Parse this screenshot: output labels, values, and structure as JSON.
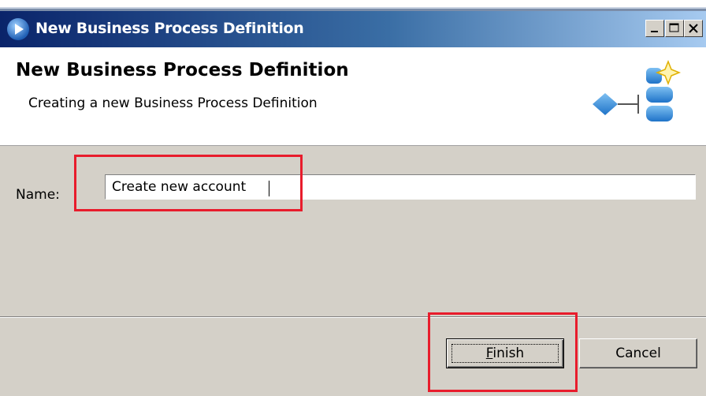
{
  "window": {
    "title": "New Business Process Definition",
    "controls": [
      "minimize",
      "maximize",
      "close"
    ]
  },
  "banner": {
    "title": "New Business Process Definition",
    "description": "Creating a new Business Process Definition",
    "icon": "process-definition-icon"
  },
  "form": {
    "name_label": "Name:",
    "name_value": "Create new account"
  },
  "buttons": {
    "finish_mnemonic": "F",
    "finish_rest": "inish",
    "cancel": "Cancel"
  },
  "colors": {
    "highlight": "#e81c2c",
    "titlebar_start": "#0a246a",
    "titlebar_end": "#a6caf0",
    "dialog_bg": "#d4d0c8"
  }
}
